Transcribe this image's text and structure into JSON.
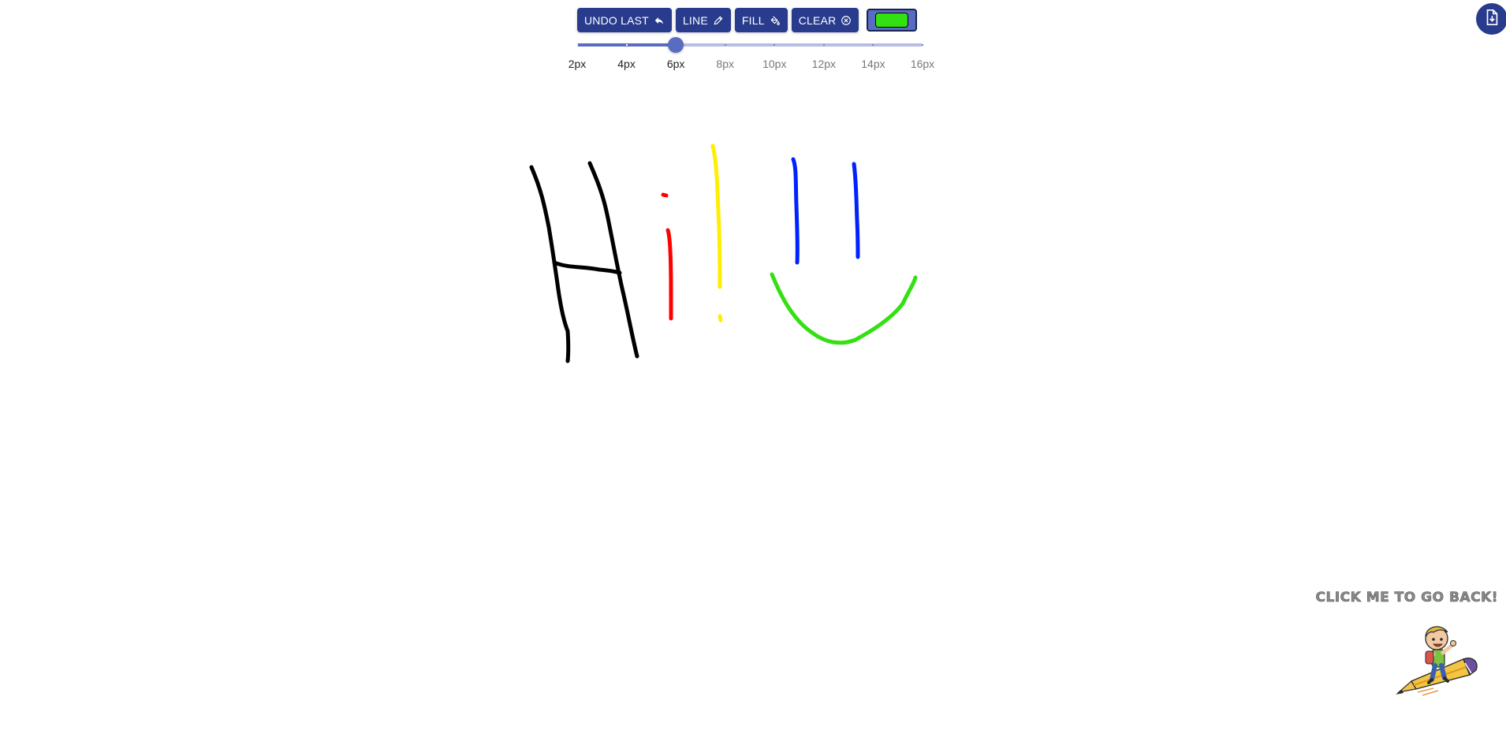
{
  "toolbar": {
    "undo_label": "UNDO LAST",
    "line_label": "LINE",
    "fill_label": "FILL",
    "clear_label": "CLEAR",
    "current_color": "#33e011",
    "accent_color": "#283b8c"
  },
  "brush_size": {
    "options": [
      "2px",
      "4px",
      "6px",
      "8px",
      "10px",
      "12px",
      "14px",
      "16px"
    ],
    "selected": "6px",
    "selected_index": 2
  },
  "canvas": {
    "strokes": [
      {
        "color": "#000000",
        "name": "H-left"
      },
      {
        "color": "#000000",
        "name": "H-right"
      },
      {
        "color": "#000000",
        "name": "H-bar"
      },
      {
        "color": "#ff0000",
        "name": "i-dot"
      },
      {
        "color": "#ff0000",
        "name": "i-stem"
      },
      {
        "color": "#ffee00",
        "name": "exclamation-stem"
      },
      {
        "color": "#ffee00",
        "name": "exclamation-dot"
      },
      {
        "color": "#0022ff",
        "name": "left-eye"
      },
      {
        "color": "#0022ff",
        "name": "right-eye"
      },
      {
        "color": "#33e011",
        "name": "smile"
      }
    ]
  },
  "back_link": {
    "label": "CLICK ME TO GO BACK!"
  },
  "icons": {
    "undo": "undo-icon",
    "line": "pencil-icon",
    "fill": "paint-bucket-icon",
    "clear": "close-circle-icon",
    "download": "download-file-icon"
  }
}
